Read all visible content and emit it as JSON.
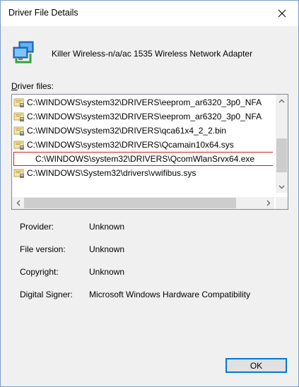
{
  "window": {
    "title": "Driver File Details",
    "close_icon": "close-icon"
  },
  "device": {
    "icon": "network-adapter-icon",
    "name": "Killer Wireless-n/a/ac 1535 Wireless Network Adapter"
  },
  "driver_files": {
    "label_accel": "D",
    "label_rest": "river files:",
    "items": [
      {
        "path": "C:\\WINDOWS\\system32\\DRIVERS\\eeprom_ar6320_3p0_NFA",
        "icon": "driver-file-icon",
        "selected": false
      },
      {
        "path": "C:\\WINDOWS\\system32\\DRIVERS\\eeprom_ar6320_3p0_NFA",
        "icon": "driver-file-icon",
        "selected": false
      },
      {
        "path": "C:\\WINDOWS\\system32\\DRIVERS\\qca61x4_2_2.bin",
        "icon": "driver-file-icon",
        "selected": false
      },
      {
        "path": "C:\\WINDOWS\\system32\\DRIVERS\\Qcamain10x64.sys",
        "icon": "driver-file-icon",
        "selected": false
      },
      {
        "path": "C:\\WINDOWS\\system32\\DRIVERS\\QcomWlanSrvx64.exe",
        "icon": "driver-file-icon",
        "selected": true
      },
      {
        "path": "C:\\WINDOWS\\System32\\drivers\\vwifibus.sys",
        "icon": "driver-file-icon",
        "selected": false
      }
    ],
    "vertical_scroll": {
      "up_icon": "chevron-up-icon",
      "down_icon": "chevron-down-icon"
    },
    "horizontal_scroll": {
      "left_icon": "chevron-left-icon",
      "right_icon": "chevron-right-icon"
    }
  },
  "properties": [
    {
      "label": "Provider:",
      "value": "Unknown"
    },
    {
      "label": "File version:",
      "value": "Unknown"
    },
    {
      "label": "Copyright:",
      "value": "Unknown"
    },
    {
      "label": "Digital Signer:",
      "value": "Microsoft Windows Hardware Compatibility"
    }
  ],
  "buttons": {
    "ok": "OK"
  },
  "colors": {
    "selection_outline": "#d42020",
    "focus_border": "#0078d7"
  }
}
